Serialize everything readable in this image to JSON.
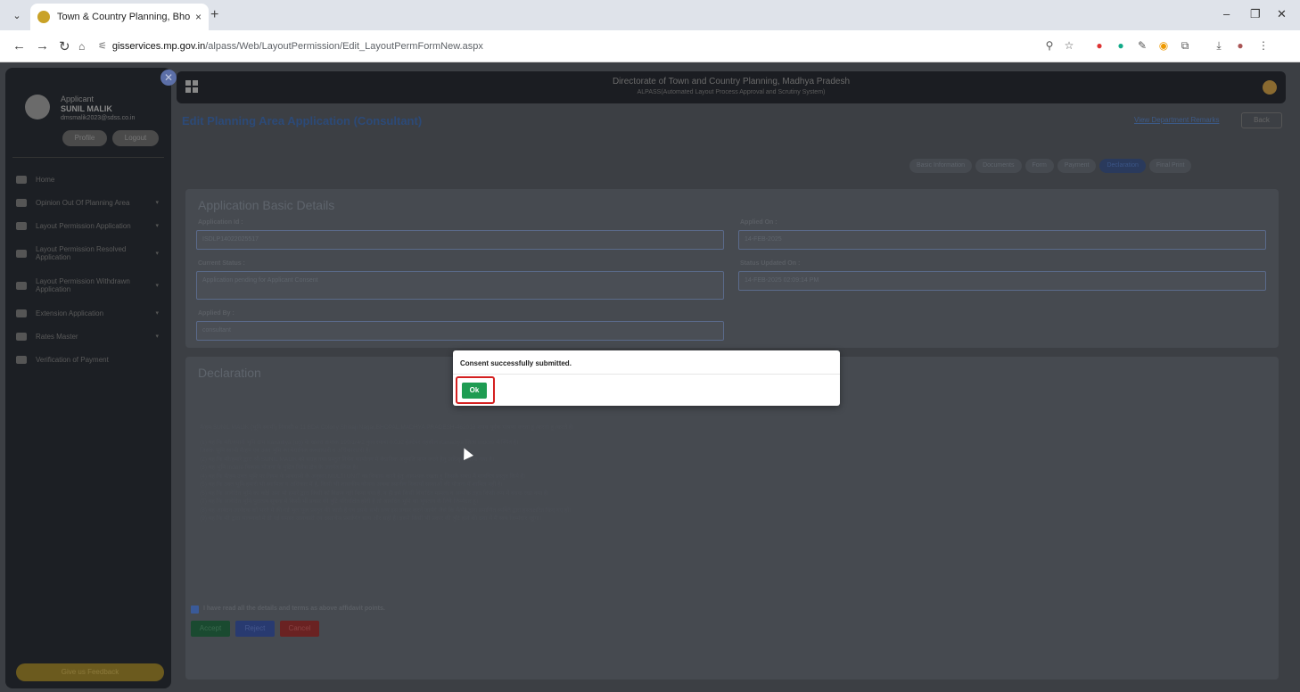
{
  "browser": {
    "tab_title": "Town & Country Planning, Bhop",
    "tab_close": "×",
    "new_tab": "+",
    "url_host": "gisservices.mp.gov.in",
    "url_path": "/alpass/Web/LayoutPermission/Edit_LayoutPermFormNew.aspx",
    "icons": [
      "tab-search-icon",
      "back-icon",
      "forward-icon",
      "reload-icon",
      "home-icon",
      "site-info-icon",
      "zoom-icon",
      "bookmark-star-icon",
      "extension-icon",
      "extensions-puzzle-icon",
      "download-icon",
      "profile-icon",
      "menu-dots-icon"
    ]
  },
  "sidebar": {
    "role": "Applicant",
    "name": "SUNIL MALIK",
    "email": "dmsmalik2023@sdss.co.in",
    "profile_btn": "Profile",
    "logout_btn": "Logout",
    "items": [
      {
        "label": "Home"
      },
      {
        "label": "Opinion Out Of Planning Area"
      },
      {
        "label": "Layout Permission Application"
      },
      {
        "label": "Layout Permission Resolved Application"
      },
      {
        "label": "Layout Permission Withdrawn Application"
      },
      {
        "label": "Extension Application"
      },
      {
        "label": "Rates Master"
      },
      {
        "label": "Verification of Payment"
      }
    ],
    "feedback_btn": "Give us Feedback"
  },
  "header": {
    "title": "Directorate of Town and Country Planning, Madhya Pradesh",
    "subtitle": "ALPASS(Automated Layout Process Approval and Scrutiny System)"
  },
  "page": {
    "title": "Edit Planning Area Application (Consultant)",
    "view_remarks": "View Department Remarks",
    "back_btn": "Back",
    "steps": [
      "Basic Information",
      "Documents",
      "Form",
      "Payment",
      "Declaration",
      "Final Print"
    ]
  },
  "basic": {
    "title": "Application Basic Details",
    "app_id_label": "Application Id :",
    "app_id_value": "ISDLP14022025517",
    "applied_on_label": "Applied On :",
    "applied_on_value": "14-FEB-2025",
    "status_label": "Current Status :",
    "status_value": "Application pending for Applicant Consent",
    "status_updated_label": "Status Updated On :",
    "status_updated_value": "14-FEB-2025 02:09:14 PM",
    "applied_by_label": "Applied By :",
    "applied_by_value": "consultant"
  },
  "declaration": {
    "title": "Declaration",
    "intro": "मैं/हम SUNIL MALIK (भूमि स्वामी) निवासी e 11 BDA Colony Shivaji Nagar,BHOPAL,MADHYA PRADESH-462016 शपथ पूर्वक घोषणा करता हूं /करती हूं /करते हैं।",
    "lines": [
      "(1) यह कि मेरी/हमारी भूमि ग्राम Kanadiya (ug) के खसरा क्रमांक 199/1/4/2 कुल रकबा 0.032 हेक्टेयर तहसील Kanadiya जिला Indore में स्थित है।",
      "जिसके भूमि स्वामी मैं/हम एवं उक्त भूमि का वैधानिक कब्जाधारी व अधिकारधारी है।",
      "(2) यह कि मेरे/हमारे द्वारा श्री SUNIL MALIK को संग्रह तथा प्रस्तुत निवेश कार्यालय में वैधानिक अनुमति प्राप्त करने हेतु अधिकृत किया गया है।",
      "(3) यह भूमि Indore विकास योजना के मुद्रित निवेश क्षेत्र के अंतर्गत स्थित है।",
      "(4) यह कि मैं/हम उक्त भूमि पर नियम के प्रावधानों के अनुसार MULTI UNIT का विकास करने हेतु आवश्यक रखता हूं जिसके संबंध में मानचित्र प्रस्तुत किये हैं।",
      "(5) यह कि उक्त भूमि हमारी भी स्वामित्व व अधिकार में है, किसी भी शासकीय योजना अथवा स्थानीय निकायों संस्थाओं की योजना में शामिल नहीं है।",
      "(6) यह कि आवेदित भूमि का कोई अंश भी हमारे द्वारा किसी को विक्रय नहीं किया गया है, न ही इसे किसी विवादित मामला व अन्य के तहत किसी रूप में बंधक रखा गया है।",
      "(7) यह कि आवेदित भूमि पुरातत्व सूचना में किसी भी प्रकार की त्रुटि परिलक्षित होती है तो आवेदित भूमि का भुगतान के लिये जिम्मेदार हूं।",
      "(8) यह आवेदन आवेदक को भरने में की गई भूल चूक प्रस्तुत की जाती है एवं इसके सभी तथ्य इस प्रकार करने जायेंगे जैसे कि मैं/मेरे द्वारा प्रमाणित व्यक्ति द्वारा हस्ताक्षरित किए गए हों।",
      "(9) यह कि मेरे द्वारा संलग्नकों में दी गई समस्त जानकारी एवं दस्तावेज प्रमाणित सत्य और सही हैं। इसमें किसी भी प्रकार की त्रुटि होने की दशा में मैं स्वयं जिम्मेदार रहूंगा।"
    ],
    "agree_label": "I have read all the details and terms as above affidavit points.",
    "accept_btn": "Accept",
    "reject_btn": "Reject",
    "cancel_btn": "Cancel"
  },
  "modal": {
    "message": "Consent successfully submitted.",
    "ok_btn": "Ok"
  }
}
